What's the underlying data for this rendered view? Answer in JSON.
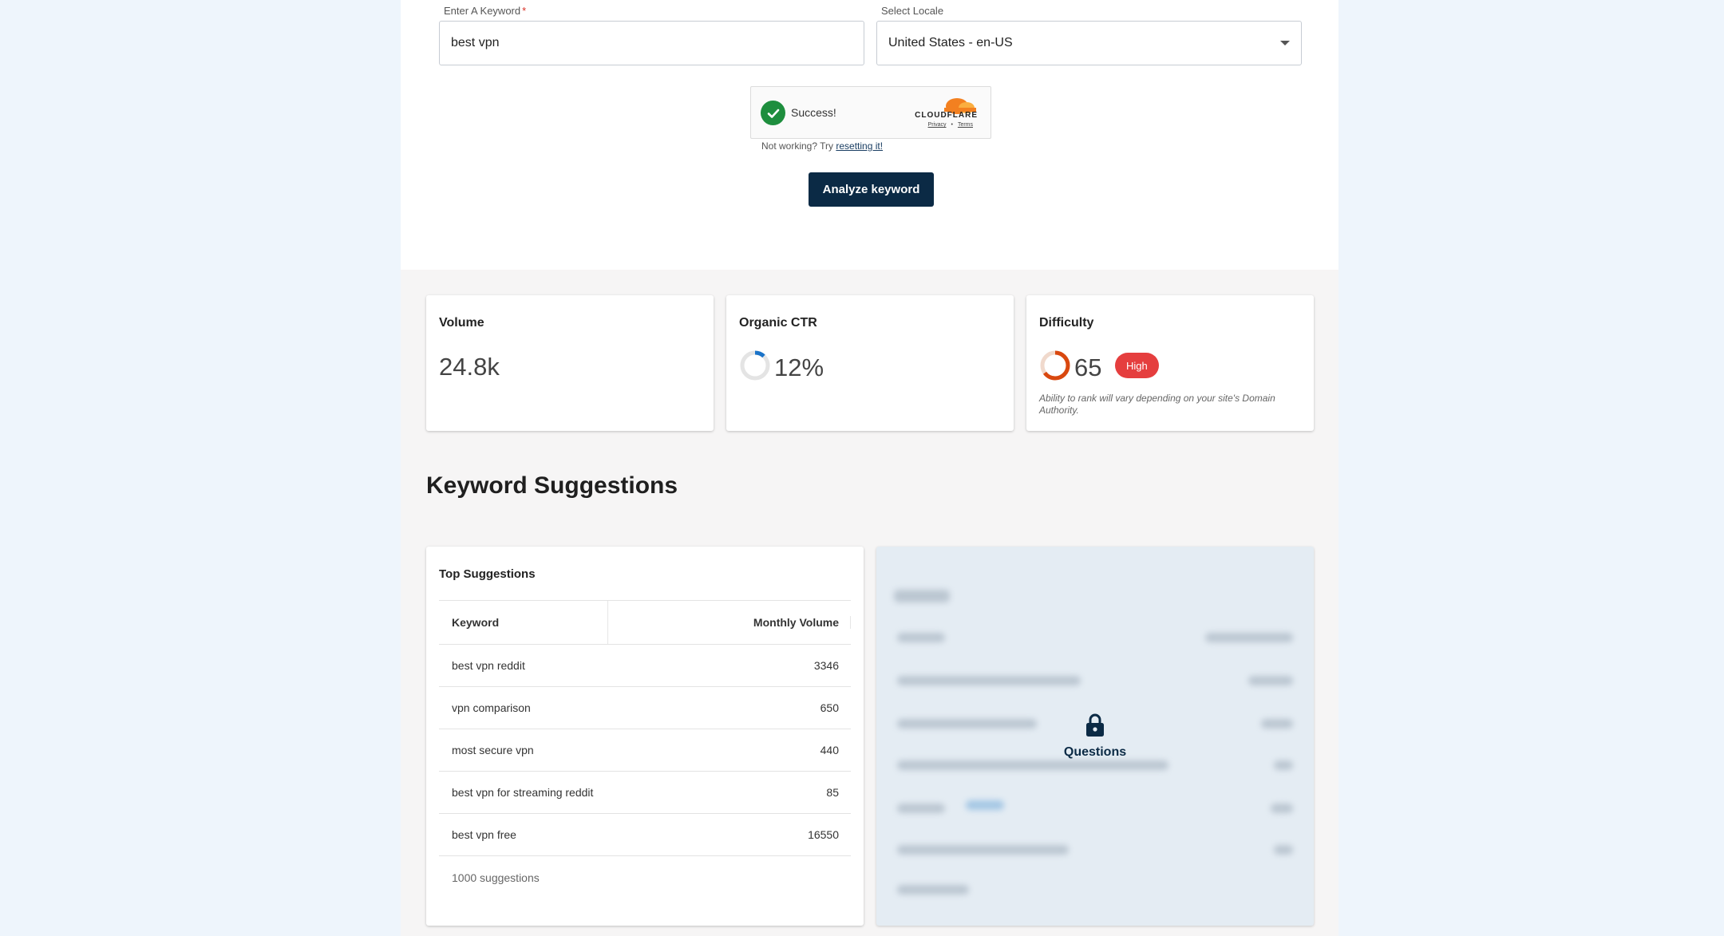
{
  "form": {
    "keyword_label": "Enter A Keyword",
    "keyword_required_mark": "*",
    "keyword_value": "best vpn",
    "locale_label": "Select Locale",
    "locale_value": "United States - en-US",
    "captcha": {
      "status": "Success!",
      "brand": "CLOUDFLARE",
      "privacy_link": "Privacy",
      "separator": "•",
      "terms_link": "Terms",
      "help_text": "Not working? Try",
      "help_link": "resetting it!"
    },
    "analyze_button": "Analyze keyword"
  },
  "metrics": {
    "volume": {
      "title": "Volume",
      "value": "24.8k"
    },
    "ctr": {
      "title": "Organic CTR",
      "value": "12%",
      "fraction": 0.12
    },
    "difficulty": {
      "title": "Difficulty",
      "value": "65",
      "score": 65,
      "badge": "High",
      "note": "Ability to rank will vary depending on your site's Domain Authority."
    }
  },
  "suggestions": {
    "section_title": "Keyword Suggestions",
    "card_title": "Top Suggestions",
    "columns": [
      "Keyword",
      "Monthly Volume"
    ],
    "rows": [
      {
        "keyword": "best vpn reddit",
        "volume": "3346"
      },
      {
        "keyword": "vpn comparison",
        "volume": "650"
      },
      {
        "keyword": "most secure vpn",
        "volume": "440"
      },
      {
        "keyword": "best vpn for streaming reddit",
        "volume": "85"
      },
      {
        "keyword": "best vpn free",
        "volume": "16550"
      }
    ],
    "footer": "1000 suggestions"
  },
  "locked": {
    "label": "Questions",
    "icon": "lock-icon"
  },
  "colors": {
    "primary": "#0b2a45",
    "success": "#1e8e3e",
    "danger": "#e53e3e",
    "ctr_ring": "#1a73c8",
    "difficulty_ring": "#d9480f"
  }
}
